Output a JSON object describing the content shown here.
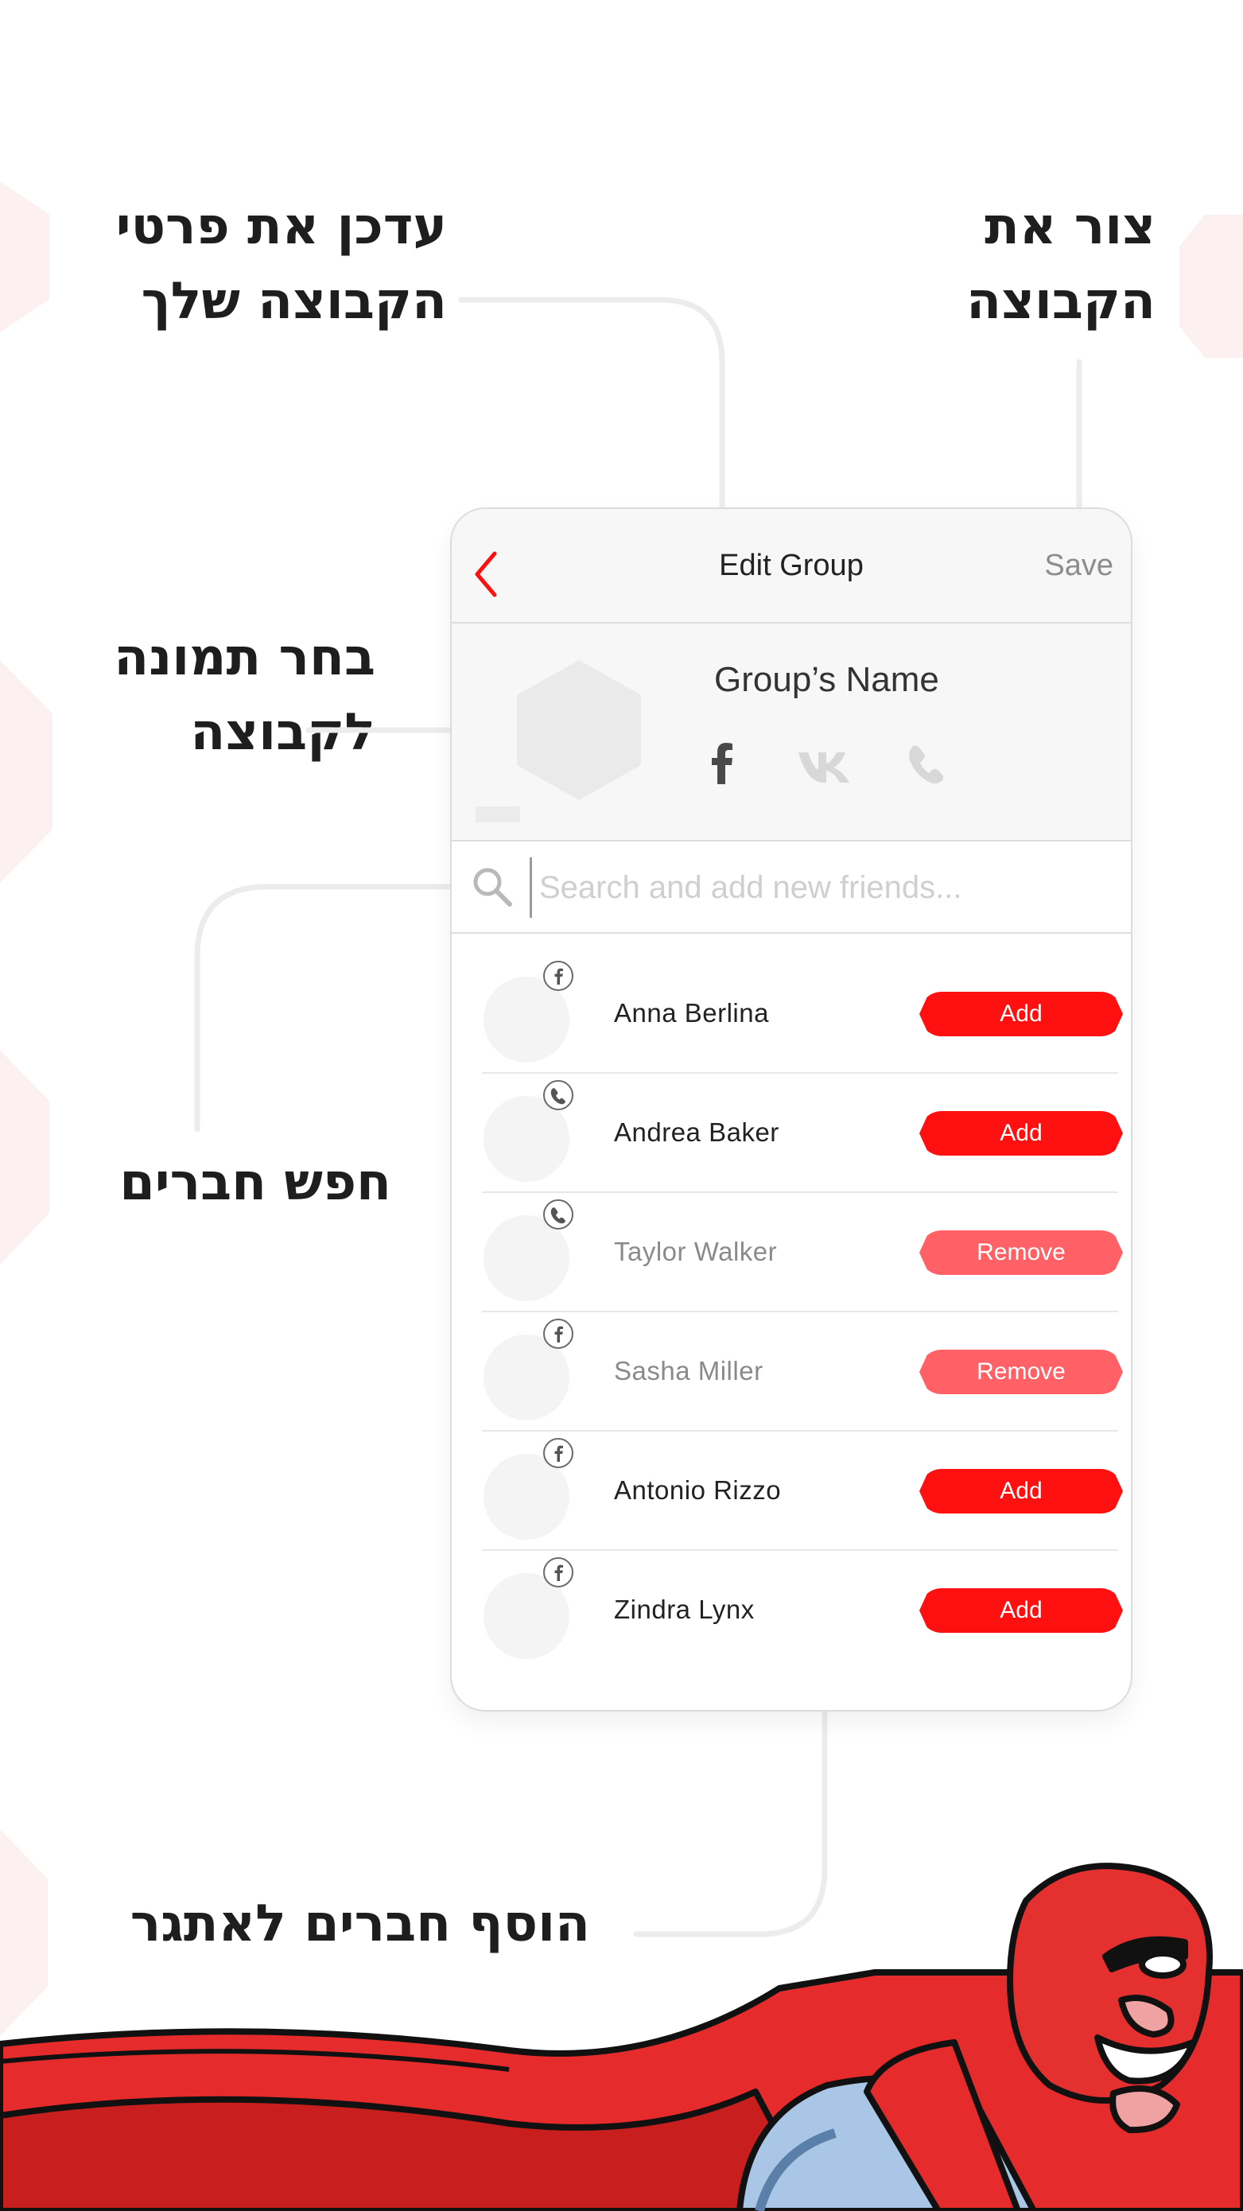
{
  "annotations": {
    "update_details": [
      "עדכן את פרטי",
      "הקבוצה שלך"
    ],
    "close_group": [
      "צור את",
      "הקבוצה"
    ],
    "choose_photo": [
      "בחר תמונה",
      "לקבוצה"
    ],
    "search_friends": [
      "חפש חברים"
    ],
    "add_friends": [
      "הוסף חברים לאתגר"
    ]
  },
  "navbar": {
    "title": "Edit Group",
    "save_label": "Save"
  },
  "group": {
    "name": "Group’s Name",
    "social_icons": [
      "facebook-icon",
      "vk-icon",
      "phone-icon"
    ]
  },
  "search": {
    "placeholder": "Search and add new friends..."
  },
  "friends": [
    {
      "name": "Anna Berlina",
      "network": "facebook",
      "action": "Add",
      "state": "active"
    },
    {
      "name": "Andrea Baker",
      "network": "phone",
      "action": "Add",
      "state": "active"
    },
    {
      "name": "Taylor Walker",
      "network": "phone",
      "action": "Remove",
      "state": "muted"
    },
    {
      "name": "Sasha Miller",
      "network": "facebook",
      "action": "Remove",
      "state": "muted"
    },
    {
      "name": "Antonio Rizzo",
      "network": "facebook",
      "action": "Add",
      "state": "active"
    },
    {
      "name": "Zindra Lynx",
      "network": "facebook",
      "action": "Add",
      "state": "active"
    }
  ],
  "colors": {
    "accent": "#ff1010",
    "accent_muted": "#ff6166",
    "text_dark": "#222222",
    "text_muted": "#8a8a8a"
  }
}
